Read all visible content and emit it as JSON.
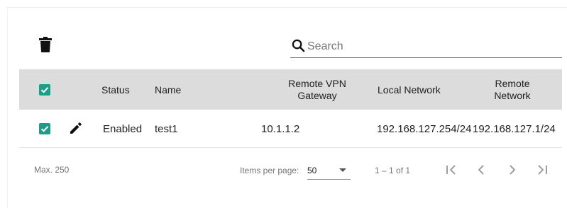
{
  "toolbar": {
    "delete_icon": "trash-icon"
  },
  "search": {
    "placeholder": "Search",
    "value": "",
    "icon": "search-icon"
  },
  "table": {
    "columns": {
      "status": "Status",
      "name": "Name",
      "remote_vpn_gateway_line1": "Remote VPN",
      "remote_vpn_gateway_line2": "Gateway",
      "local_network": "Local Network",
      "remote_network_line1": "Remote",
      "remote_network_line2": "Network"
    },
    "select_all_checked": true,
    "rows": [
      {
        "checked": true,
        "edit_icon": "pencil-icon",
        "status": "Enabled",
        "name": "test1",
        "remote_vpn_gateway": "10.1.1.2",
        "local_network": "192.168.127.254/24",
        "remote_network": "192.168.127.1/24"
      }
    ]
  },
  "footer": {
    "max_label": "Max. 250",
    "items_per_page_label": "Items per page:",
    "items_per_page_value": "50",
    "range_label": "1 – 1 of 1"
  },
  "colors": {
    "accent": "#1f9c87",
    "header_bg": "#dcdcdc"
  }
}
